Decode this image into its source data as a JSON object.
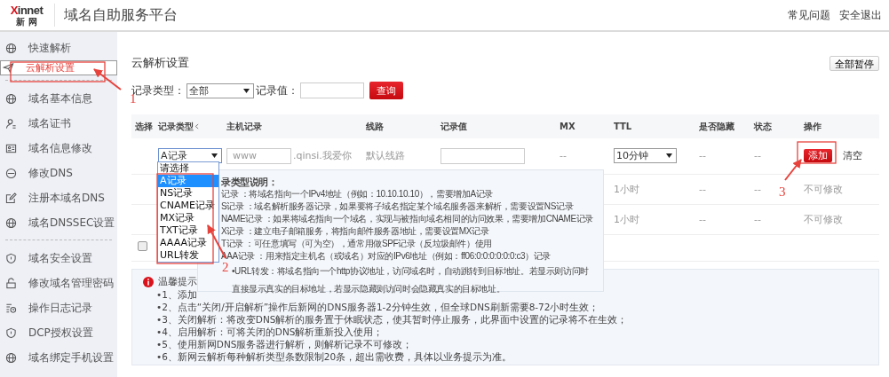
{
  "header": {
    "logo": {
      "text": "Xinnet",
      "subtitle": "新 网"
    },
    "title": "域名自助服务平台",
    "links": [
      "常见问题",
      "安全退出"
    ]
  },
  "sidebar": {
    "groups": [
      [
        {
          "label": "快速解析",
          "selected": false
        },
        {
          "label": "云解析设置",
          "selected": true
        }
      ],
      [
        {
          "label": "域名基本信息",
          "selected": false
        },
        {
          "label": "域名证书",
          "selected": false
        },
        {
          "label": "域名信息修改",
          "selected": false
        },
        {
          "label": "修改DNS",
          "selected": false
        },
        {
          "label": "注册本域名DNS",
          "selected": false
        },
        {
          "label": "域名DNSSEC设置",
          "selected": false
        }
      ],
      [
        {
          "label": "域名安全设置",
          "selected": false
        },
        {
          "label": "修改域名管理密码",
          "selected": false
        },
        {
          "label": "操作日志记录",
          "selected": false
        },
        {
          "label": "DCP授权设置",
          "selected": false
        },
        {
          "label": "域名绑定手机设置",
          "selected": false
        }
      ]
    ]
  },
  "page_title": "云解析设置",
  "pause_all_button": "全部暂停",
  "filter": {
    "type_label": "记录类型：",
    "type_value": "全部",
    "value_label": "记录值：",
    "search_button": "查询"
  },
  "table": {
    "columns": [
      "选择",
      "记录类型",
      "主机记录",
      "线路",
      "记录值",
      "MX",
      "TTL",
      "是否隐藏",
      "状态",
      "操作"
    ],
    "new_row": {
      "record_type": "A记录",
      "host_placeholder": "www",
      "host_suffix": ".qinsi.我爱你",
      "line": "默认线路",
      "mx": "--",
      "ttl": "10分钟",
      "hidden": "--",
      "status": "--",
      "add_button": "添加",
      "clear_link": "清空"
    },
    "rows": [
      {
        "ttl": "1小时",
        "hidden": "--",
        "status": "--",
        "operation": "不可修改"
      },
      {
        "ttl": "1小时",
        "hidden": "--",
        "status": "--",
        "operation": "不可修改"
      },
      {
        "checked": false
      }
    ]
  },
  "record_type_dropdown": [
    {
      "label": "请选择",
      "selected": false
    },
    {
      "label": "A记录",
      "selected": true
    },
    {
      "label": "NS记录",
      "selected": false
    },
    {
      "label": "CNAME记录",
      "selected": false
    },
    {
      "label": "MX记录",
      "selected": false
    },
    {
      "label": "TXT记录",
      "selected": false
    },
    {
      "label": "AAAA记录",
      "selected": false
    },
    {
      "label": "URL转发",
      "selected": false
    }
  ],
  "type_help_popover": {
    "title": "录类型说明：",
    "lines": [
      "记录 ：将域名指向一个IPv4地址（例如：10.10.10.10），需要增加A记录",
      "S记录 ：域名解析服务器记录，如果要将子域名指定某个域名服务器来解析，需要设置NS记录",
      "NAME记录 ：如果将域名指向一个域名，实现与被指向域名相同的访问效果，需要增加CNAME记录",
      "X记录 ：建立电子邮箱服务，将指向邮件服务器地址，需要设置MX记录",
      "T记录 ：可任意填写（可为空），通常用做SPF记录（反垃圾邮件）使用",
      "AAA记录 ：用来指定主机名（或域名）对应的IPv6地址（例如：ff06:0:0:0:0:0:0:c3）记录"
    ],
    "note": "•URL转发：将域名指向一个http协议地址，访问域名时，自动跳转到目标地址。若显示则访问时直接显示真实的目标地址，若显示隐藏则访问时会隐藏真实的目标地址。"
  },
  "tips": {
    "title": "温馨提示",
    "items": [
      "•1、添加",
      "•2、点击“关闭/开启解析”操作后新网的DNS服务器1-2分钟生效，但全球DNS刷新需要8-72小时生效；",
      "•3、关闭解析：将改变DNS解析的服务置于休眠状态，使其暂时停止服务，此界面中设置的记录将不在生效；",
      "•4、启用解析：可将关闭的DNS解析重新投入使用；",
      "•5、使用新网DNS服务器进行解析，则解析记录不可修改；",
      "•6、新网云解析每种解析类型条数限制20条，超出需收费，具体以业务提示为准。"
    ]
  },
  "annotations": [
    {
      "label": "1"
    },
    {
      "label": "2"
    },
    {
      "label": "3"
    }
  ]
}
